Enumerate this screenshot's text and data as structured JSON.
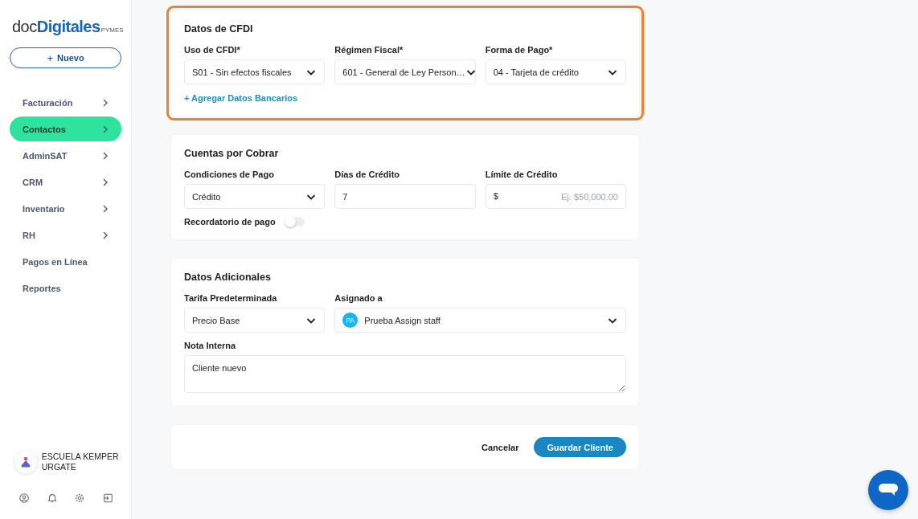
{
  "sidebar": {
    "logo": {
      "part_1": "doc",
      "part_2": "Digitales",
      "suffix": "PYMES"
    },
    "new_button": {
      "icon": "+",
      "label": "Nuevo"
    },
    "items": [
      {
        "label": "Facturación",
        "expandable": true,
        "selected": false
      },
      {
        "label": "Contactos",
        "expandable": true,
        "selected": true
      },
      {
        "label": "AdminSAT",
        "expandable": true,
        "selected": false
      },
      {
        "label": "CRM",
        "expandable": true,
        "selected": false
      },
      {
        "label": "Inventario",
        "expandable": true,
        "selected": false
      },
      {
        "label": "RH",
        "expandable": true,
        "selected": false
      },
      {
        "label": "Pagos en Línea",
        "expandable": false,
        "selected": false
      },
      {
        "label": "Reportes",
        "expandable": false,
        "selected": false
      }
    ],
    "account": {
      "name": "ESCUELA KEMPER URGATE"
    }
  },
  "sections": [
    {
      "title": "Datos de CFDI",
      "highlighted": true,
      "fields": [
        {
          "kind": "select",
          "label": "Uso de CFDI*",
          "value": "S01 - Sin efectos fiscales"
        },
        {
          "kind": "select",
          "label": "Régimen Fiscal*",
          "value": "601 - General de Ley Person…"
        },
        {
          "kind": "select",
          "label": "Forma de Pago*",
          "value": "04 - Tarjeta de crédito"
        },
        {
          "kind": "link",
          "label": "+ Agregar Datos Bancarios"
        }
      ]
    },
    {
      "title": "Cuentas por Cobrar",
      "highlighted": false,
      "fields": [
        {
          "kind": "select",
          "label": "Condiciones de Pago",
          "value": "Crédito"
        },
        {
          "kind": "input",
          "label": "Días de Crédito",
          "value": "7"
        },
        {
          "kind": "money",
          "label": "Límite de Crédito",
          "prefix": "$",
          "placeholder": "Ej. $50,000.00"
        },
        {
          "kind": "toggle",
          "label": "Recordatorio de pago",
          "on": false
        }
      ]
    },
    {
      "title": "Datos Adicionales",
      "highlighted": false,
      "fields": [
        {
          "kind": "select",
          "label": "Tarifa Predeterminada",
          "value": "Precio Base"
        },
        {
          "kind": "assignee",
          "label": "Asignado a",
          "initials": "PA",
          "value": "Prueba Assign staff"
        },
        {
          "kind": "textarea",
          "label": "Nota Interna",
          "value": "Cliente nuevo"
        }
      ]
    }
  ],
  "actions": {
    "cancel": "Cancelar",
    "save": "Guardar Cliente"
  }
}
